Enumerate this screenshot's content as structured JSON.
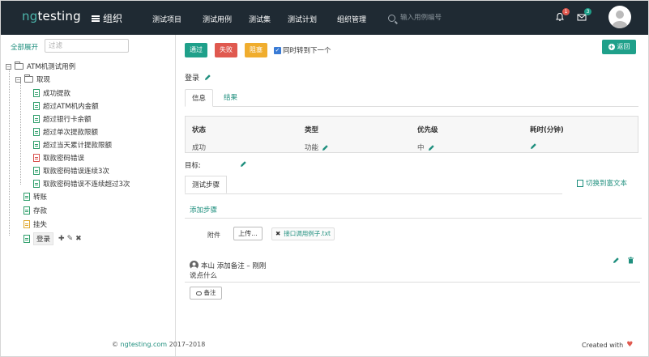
{
  "header": {
    "logo_ng": "ng",
    "logo_rest": "testing",
    "org_label": "组织",
    "nav": [
      "测试项目",
      "测试用例",
      "测试集",
      "测试计划",
      "组织管理"
    ],
    "search_placeholder": "输入用例编号",
    "notification_count": "1",
    "message_count": "3"
  },
  "sidebar": {
    "expand_all": "全部展开",
    "filter_placeholder": "过滤",
    "root": "ATM机测试用例",
    "group": "取现",
    "cases": [
      "成功提款",
      "超过ATM机内金额",
      "超过银行卡余额",
      "超过单次提款限额",
      "超过当天累计提款限额",
      "取款密码错误",
      "取款密码错误连续3次",
      "取款密码错误不连续超过3次"
    ],
    "top_items": [
      "转账",
      "存款",
      "挂失",
      "登录"
    ]
  },
  "toolbar": {
    "pass": "通过",
    "fail": "失败",
    "block": "阻塞",
    "next_label": "同时转到下一个",
    "back": "返回"
  },
  "case": {
    "title": "登录",
    "tabs": {
      "info": "信息",
      "result": "结果"
    },
    "info": {
      "status_hd": "状态",
      "status": "成功",
      "type_hd": "类型",
      "type": "功能",
      "priority_hd": "优先级",
      "priority": "中",
      "time_hd": "耗时(分钟)"
    },
    "goal_label": "目标:",
    "steps_tab": "测试步骤",
    "switch_rich": "切换到富文本",
    "add_step": "添加步骤",
    "attachment_label": "附件",
    "upload": "上传...",
    "attachment_file": "接口调用例子.txt",
    "comment_meta": "本山 添加备注 – 刚刚",
    "comment_body": "说点什么",
    "note_btn": "备注"
  },
  "footer": {
    "copy": "©",
    "site": "ngtesting.com",
    "years": "2017–2018",
    "created": "Created with"
  },
  "colors": {
    "header_bg": "#1f2a33",
    "accent": "#1fa08a",
    "fail": "#e0594f",
    "block": "#f0ad2e"
  }
}
